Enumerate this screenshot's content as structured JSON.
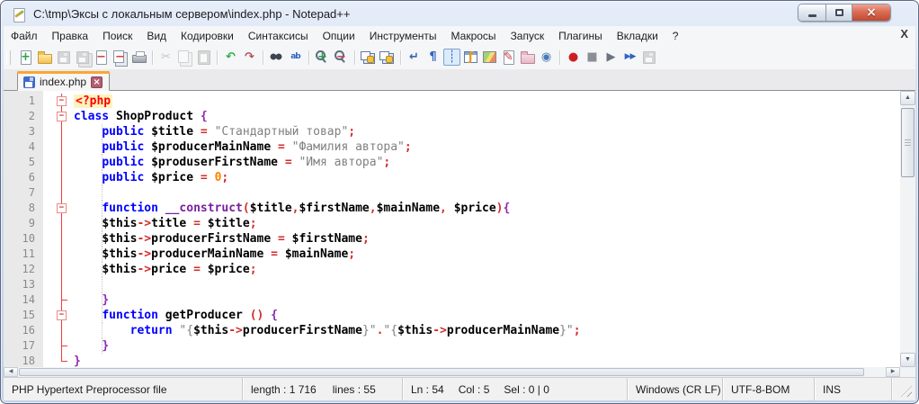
{
  "window": {
    "title": "C:\\tmp\\Эксы с локальным сервером\\index.php - Notepad++"
  },
  "menu": {
    "items": [
      "Файл",
      "Правка",
      "Поиск",
      "Вид",
      "Кодировки",
      "Синтаксисы",
      "Опции",
      "Инструменты",
      "Макросы",
      "Запуск",
      "Плагины",
      "Вкладки",
      "?"
    ],
    "close": "X"
  },
  "toolbar": {
    "icons": [
      {
        "n": "new-file",
        "base": "page",
        "g": "+",
        "c": "#27a348"
      },
      {
        "n": "open-file",
        "base": "folder"
      },
      {
        "n": "save",
        "base": "floppy",
        "dis": true
      },
      {
        "n": "save-all",
        "base": "floppy2",
        "dis": true
      },
      {
        "n": "close-file",
        "base": "page",
        "g": "−",
        "c": "#d43f3f"
      },
      {
        "n": "close-all-files",
        "base": "pages",
        "g": "−",
        "c": "#d43f3f"
      },
      {
        "n": "print",
        "base": "printer"
      },
      {
        "sep": true
      },
      {
        "n": "cut",
        "g": "✂",
        "c": "#6b7280",
        "dis": true
      },
      {
        "n": "copy",
        "base": "pages",
        "dis": true
      },
      {
        "n": "paste",
        "base": "clip",
        "dis": true
      },
      {
        "sep": true
      },
      {
        "n": "undo",
        "g": "↶",
        "c": "#2fae4a"
      },
      {
        "n": "redo",
        "g": "↷",
        "c": "#b05555"
      },
      {
        "sep": true
      },
      {
        "n": "find",
        "base": "binoc"
      },
      {
        "n": "replace",
        "g": "ab",
        "c": "#2f62c4"
      },
      {
        "sep": true
      },
      {
        "n": "zoom-in",
        "base": "lens",
        "g": "+",
        "c": "#27a348"
      },
      {
        "n": "zoom-out",
        "base": "lens",
        "g": "−",
        "c": "#d43f3f"
      },
      {
        "sep": true
      },
      {
        "n": "sync-vertical-scrolling",
        "base": "winlock"
      },
      {
        "n": "sync-horizontal-scrolling",
        "base": "winlock"
      },
      {
        "sep": true
      },
      {
        "n": "word-wrap",
        "g": "↵",
        "c": "#3a66b0"
      },
      {
        "n": "show-all-characters",
        "g": "¶",
        "c": "#2f62c4"
      },
      {
        "n": "show-indent-guide",
        "g": "┊",
        "c": "#2f62c4",
        "pressed": true
      },
      {
        "n": "function-list",
        "base": "win",
        "g": "ƒ",
        "c": "#e09a2b"
      },
      {
        "n": "document-map",
        "base": "map"
      },
      {
        "n": "document-list",
        "base": "page",
        "g": "✎",
        "c": "#c23535"
      },
      {
        "n": "folder-as-workspace",
        "base": "folderp"
      },
      {
        "n": "monitoring",
        "g": "◉",
        "c": "#4a7ab5"
      },
      {
        "sep": true
      },
      {
        "n": "macro-record",
        "g": "●",
        "c": "#cc2020"
      },
      {
        "n": "macro-stop",
        "g": "■",
        "c": "#8a8f96"
      },
      {
        "n": "macro-playback",
        "g": "▶",
        "c": "#6b7280"
      },
      {
        "n": "macro-run-multiple",
        "g": "▶▶",
        "c": "#2f62c4"
      },
      {
        "n": "macro-save",
        "base": "floppy",
        "dis": true
      }
    ]
  },
  "tab": {
    "label": "index.php"
  },
  "editor": {
    "lines": [
      {
        "n": 1,
        "f": "box",
        "t": [
          [
            "<?php",
            "tag"
          ]
        ]
      },
      {
        "n": 2,
        "f": "box",
        "t": [
          [
            "class",
            "kw"
          ],
          [
            " ",
            "pl"
          ],
          [
            "ShopProduct",
            "cls"
          ],
          [
            " ",
            "pl"
          ],
          [
            "{",
            "brc"
          ]
        ]
      },
      {
        "n": 3,
        "f": "line",
        "t": [
          [
            "    ",
            "pl"
          ],
          [
            "public",
            "kw"
          ],
          [
            " ",
            "pl"
          ],
          [
            "$title",
            "var"
          ],
          [
            " ",
            "pl"
          ],
          [
            "=",
            "op"
          ],
          [
            " ",
            "pl"
          ],
          [
            "\"Стандартный товар\"",
            "str"
          ],
          [
            ";",
            "op"
          ]
        ]
      },
      {
        "n": 4,
        "f": "line",
        "t": [
          [
            "    ",
            "pl"
          ],
          [
            "public",
            "kw"
          ],
          [
            " ",
            "pl"
          ],
          [
            "$producerMainName",
            "var"
          ],
          [
            " ",
            "pl"
          ],
          [
            "=",
            "op"
          ],
          [
            " ",
            "pl"
          ],
          [
            "\"Фамилия автора\"",
            "str"
          ],
          [
            ";",
            "op"
          ]
        ]
      },
      {
        "n": 5,
        "f": "line",
        "t": [
          [
            "    ",
            "pl"
          ],
          [
            "public",
            "kw"
          ],
          [
            " ",
            "pl"
          ],
          [
            "$produserFirstName",
            "var"
          ],
          [
            " ",
            "pl"
          ],
          [
            "=",
            "op"
          ],
          [
            " ",
            "pl"
          ],
          [
            "\"Имя автора\"",
            "str"
          ],
          [
            ";",
            "op"
          ]
        ]
      },
      {
        "n": 6,
        "f": "line",
        "t": [
          [
            "    ",
            "pl"
          ],
          [
            "public",
            "kw"
          ],
          [
            " ",
            "pl"
          ],
          [
            "$price",
            "var"
          ],
          [
            " ",
            "pl"
          ],
          [
            "=",
            "op"
          ],
          [
            " ",
            "pl"
          ],
          [
            "0",
            "num"
          ],
          [
            ";",
            "op"
          ]
        ]
      },
      {
        "n": 7,
        "f": "line",
        "t": []
      },
      {
        "n": 8,
        "f": "box",
        "t": [
          [
            "    ",
            "pl"
          ],
          [
            "function",
            "kw"
          ],
          [
            " ",
            "pl"
          ],
          [
            "__construct",
            "fn"
          ],
          [
            "(",
            "op"
          ],
          [
            "$title",
            "var"
          ],
          [
            ",",
            "op"
          ],
          [
            "$firstName",
            "var"
          ],
          [
            ",",
            "op"
          ],
          [
            "$mainName",
            "var"
          ],
          [
            ",",
            "op"
          ],
          [
            " ",
            "pl"
          ],
          [
            "$price",
            "var"
          ],
          [
            ")",
            "op"
          ],
          [
            "{",
            "brc"
          ]
        ]
      },
      {
        "n": 9,
        "f": "line",
        "t": [
          [
            "    ",
            "pl"
          ],
          [
            "$this",
            "var"
          ],
          [
            "->",
            "op"
          ],
          [
            "title",
            "var"
          ],
          [
            " ",
            "pl"
          ],
          [
            "=",
            "op"
          ],
          [
            " ",
            "pl"
          ],
          [
            "$title",
            "var"
          ],
          [
            ";",
            "op"
          ]
        ]
      },
      {
        "n": 10,
        "f": "line",
        "t": [
          [
            "    ",
            "pl"
          ],
          [
            "$this",
            "var"
          ],
          [
            "->",
            "op"
          ],
          [
            "producerFirstName",
            "var"
          ],
          [
            " ",
            "pl"
          ],
          [
            "=",
            "op"
          ],
          [
            " ",
            "pl"
          ],
          [
            "$firstName",
            "var"
          ],
          [
            ";",
            "op"
          ]
        ]
      },
      {
        "n": 11,
        "f": "line",
        "t": [
          [
            "    ",
            "pl"
          ],
          [
            "$this",
            "var"
          ],
          [
            "->",
            "op"
          ],
          [
            "producerMainName",
            "var"
          ],
          [
            " ",
            "pl"
          ],
          [
            "=",
            "op"
          ],
          [
            " ",
            "pl"
          ],
          [
            "$mainName",
            "var"
          ],
          [
            ";",
            "op"
          ]
        ]
      },
      {
        "n": 12,
        "f": "line",
        "t": [
          [
            "    ",
            "pl"
          ],
          [
            "$this",
            "var"
          ],
          [
            "->",
            "op"
          ],
          [
            "price",
            "var"
          ],
          [
            " ",
            "pl"
          ],
          [
            "=",
            "op"
          ],
          [
            " ",
            "pl"
          ],
          [
            "$price",
            "var"
          ],
          [
            ";",
            "op"
          ]
        ]
      },
      {
        "n": 13,
        "f": "line",
        "t": []
      },
      {
        "n": 14,
        "f": "tick",
        "t": [
          [
            "    ",
            "pl"
          ],
          [
            "}",
            "brc"
          ]
        ]
      },
      {
        "n": 15,
        "f": "box",
        "t": [
          [
            "    ",
            "pl"
          ],
          [
            "function",
            "kw"
          ],
          [
            " ",
            "pl"
          ],
          [
            "getProducer",
            "cls"
          ],
          [
            " ",
            "pl"
          ],
          [
            "(",
            "op"
          ],
          [
            ")",
            "op"
          ],
          [
            " ",
            "pl"
          ],
          [
            "{",
            "brc"
          ]
        ]
      },
      {
        "n": 16,
        "f": "line",
        "t": [
          [
            "        ",
            "pl"
          ],
          [
            "return",
            "kw"
          ],
          [
            " ",
            "pl"
          ],
          [
            "\"{",
            "str"
          ],
          [
            "$this",
            "var"
          ],
          [
            "->",
            "op"
          ],
          [
            "producerFirstName",
            "var"
          ],
          [
            "}\"",
            "str"
          ],
          [
            ".",
            "op"
          ],
          [
            "\"{",
            "str"
          ],
          [
            "$this",
            "var"
          ],
          [
            "->",
            "op"
          ],
          [
            "producerMainName",
            "var"
          ],
          [
            "}\"",
            "str"
          ],
          [
            ";",
            "op"
          ]
        ]
      },
      {
        "n": 17,
        "f": "tick",
        "t": [
          [
            "    ",
            "pl"
          ],
          [
            "}",
            "brc"
          ]
        ]
      },
      {
        "n": 18,
        "f": "corner",
        "t": [
          [
            "}",
            "brc"
          ]
        ]
      }
    ]
  },
  "status": {
    "doctype": "PHP Hypertext Preprocessor file",
    "length": "length : 1 716",
    "lines": "lines : 55",
    "ln": "Ln : 54",
    "col": "Col : 5",
    "sel": "Sel : 0 | 0",
    "eol": "Windows (CR LF)",
    "encoding": "UTF-8-BOM",
    "mode": "INS"
  },
  "colors": {
    "accent_tab": "#faa634",
    "keyword": "#0000ff",
    "string": "#808080",
    "operator": "#d42b2b",
    "number": "#ff8000",
    "php_tag": "#ff0000",
    "fold_line": "#f03c3c"
  }
}
